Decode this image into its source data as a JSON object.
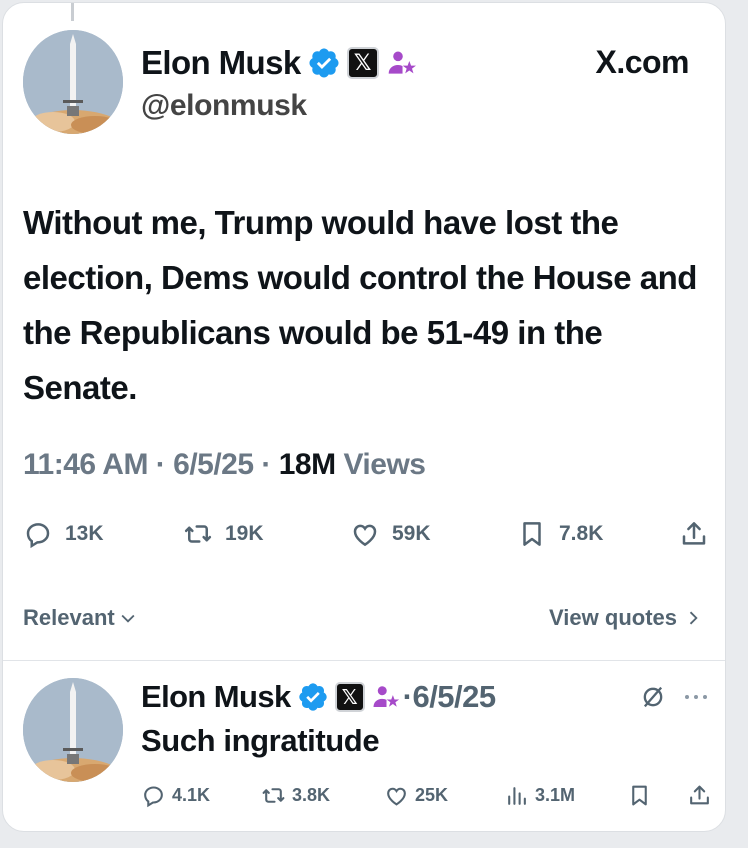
{
  "tweet": {
    "author_name": "Elon Musk",
    "handle": "@elonmusk",
    "site_label": "X.com",
    "text": "Without me, Trump would have lost the election, Dems would control the House and the Republicans would be 51-49 in the Senate.",
    "time": "11:46 AM",
    "date": "6/5/25",
    "views_count": "18M",
    "views_label": "Views",
    "separator": "·",
    "actions": {
      "replies": "13K",
      "reposts": "19K",
      "likes": "59K",
      "bookmarks": "7.8K"
    }
  },
  "sort": {
    "label": "Relevant",
    "view_quotes": "View quotes"
  },
  "reply": {
    "author_name": "Elon Musk",
    "date": "·6/5/25",
    "text": "Such ingratitude",
    "actions": {
      "replies": "4.1K",
      "reposts": "3.8K",
      "likes": "25K",
      "views": "3.1M"
    }
  },
  "badges": {
    "x_glyph": "𝕏"
  },
  "colors": {
    "verified": "#1d9bf0",
    "affiliate": "#a64ac9",
    "text": "#0f1419",
    "muted": "#536471"
  },
  "icons": [
    "verified-badge-icon",
    "x-badge-icon",
    "affiliate-icon",
    "reply-icon",
    "retweet-icon",
    "like-icon",
    "bookmark-icon",
    "share-icon",
    "views-icon",
    "grok-icon",
    "more-icon",
    "chevron-down-icon",
    "chevron-right-icon"
  ]
}
